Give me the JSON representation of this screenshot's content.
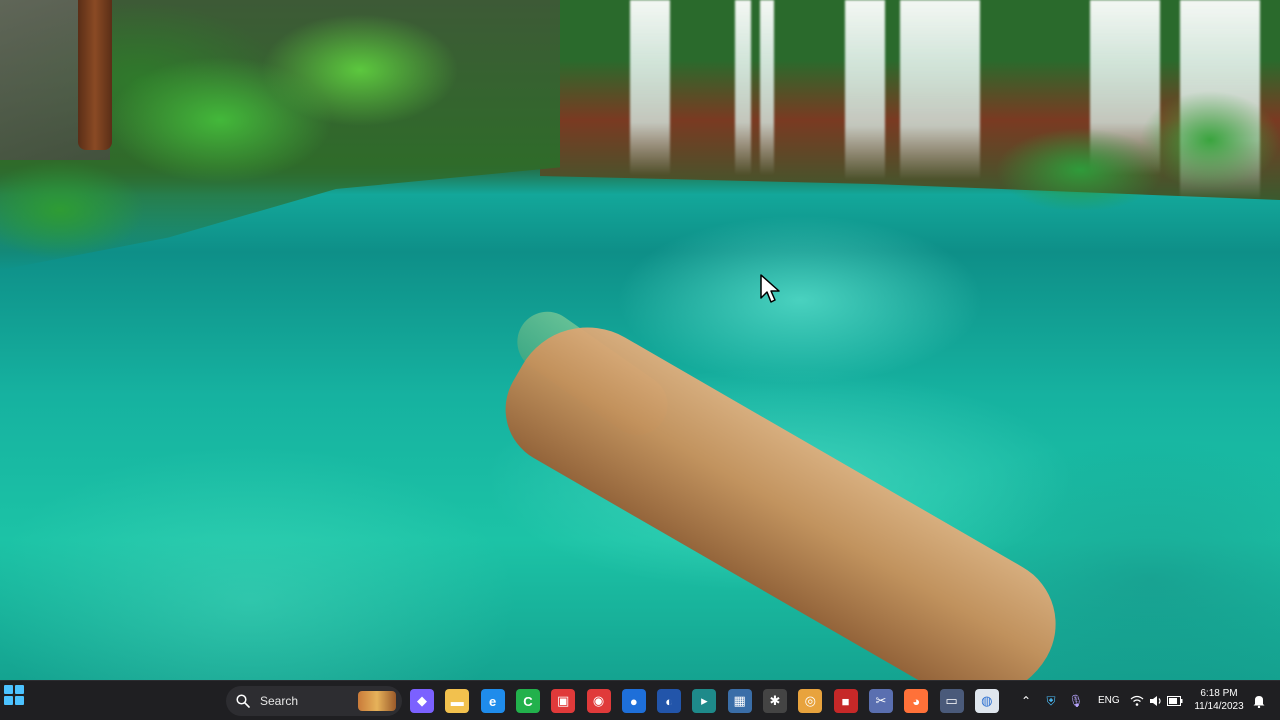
{
  "wallpaper": {
    "description_icon": "waterfall-lake-wallpaper"
  },
  "taskbar": {
    "start_icon": "windows-logo-icon",
    "search": {
      "label": "Search",
      "icon": "search-icon"
    },
    "pinned_apps": [
      {
        "name": "copilot-icon",
        "color": "#7b61ff",
        "glyph": "◆"
      },
      {
        "name": "file-explorer-icon",
        "color": "#f2c14e",
        "glyph": "▬"
      },
      {
        "name": "edge-icon",
        "color": "#1f8ceb",
        "glyph": "e"
      },
      {
        "name": "camtasia-icon",
        "color": "#22b14c",
        "glyph": "C"
      },
      {
        "name": "screen-recorder-icon",
        "color": "#e03a3a",
        "glyph": "▣"
      },
      {
        "name": "record-icon",
        "color": "#e03a3a",
        "glyph": "◉"
      },
      {
        "name": "blue-circle-app-icon",
        "color": "#1e6fd9",
        "glyph": "●"
      },
      {
        "name": "media-player-icon",
        "color": "#2255aa",
        "glyph": "◐"
      },
      {
        "name": "terminal-icon",
        "color": "#1e8a8a",
        "glyph": "▸"
      },
      {
        "name": "image-viewer-icon",
        "color": "#3a6ea8",
        "glyph": "▦"
      },
      {
        "name": "settings-app-icon",
        "color": "#444444",
        "glyph": "✱"
      },
      {
        "name": "chrome-icon",
        "color": "#e8a33d",
        "glyph": "◎"
      },
      {
        "name": "red-app-icon",
        "color": "#c62828",
        "glyph": "■"
      },
      {
        "name": "snipping-tool-icon",
        "color": "#5a6fb0",
        "glyph": "✂"
      },
      {
        "name": "firefox-icon",
        "color": "#ff7139",
        "glyph": "◕"
      },
      {
        "name": "desktop-app-icon",
        "color": "#4a5a7a",
        "glyph": "▭"
      },
      {
        "name": "chrome-app-icon",
        "color": "#dfe6ee",
        "glyph": "◍"
      }
    ],
    "tray": {
      "overflow_icon": "chevron-up-icon",
      "language": "ENG",
      "time": "6:18 PM",
      "date": "11/14/2023"
    }
  }
}
